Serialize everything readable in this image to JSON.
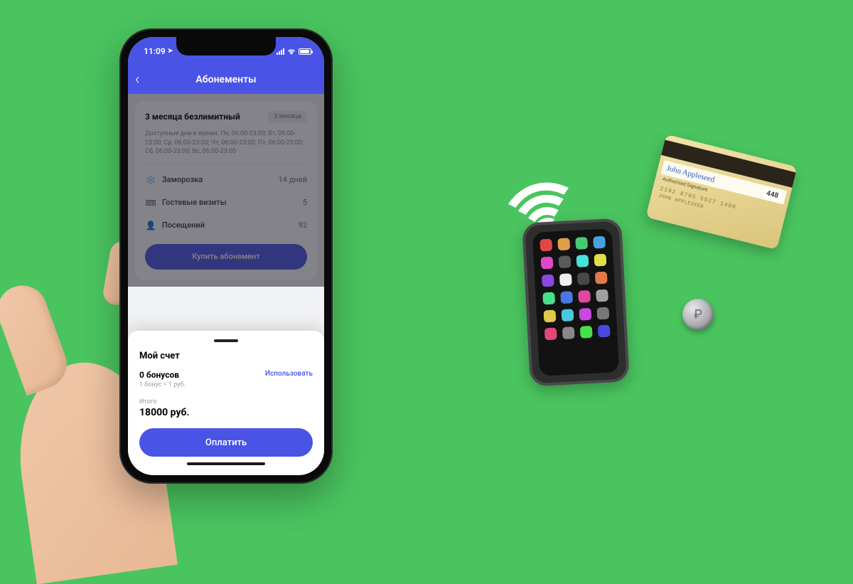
{
  "status": {
    "time": "11:09",
    "location_icon": "➤"
  },
  "nav": {
    "title": "Абонементы"
  },
  "plan": {
    "title": "3 месяца безлимитный",
    "badge": "3 месяца",
    "schedule_label": "Доступные дни и время:",
    "schedule_text": "Пн, 06:00-23:00; Вт, 06:00-23:00; Ср, 06:00-23:00; Чт, 06:00-23:00; Пт, 06:00-23:00; Сб, 06:00-23:00; Вс, 06:00-23:00",
    "rows": [
      {
        "icon": "❄️",
        "label": "Заморозка",
        "value": "14 дней"
      },
      {
        "icon": "🎟",
        "label": "Гостевые визиты",
        "value": "5"
      },
      {
        "icon": "👤",
        "label": "Посещений",
        "value": "92"
      }
    ],
    "buy_label": "Купить абонемент"
  },
  "sheet": {
    "title": "Мой счет",
    "bonus_amount": "0 бонусов",
    "bonus_rate": "1 бонус = 1 руб.",
    "use_label": "Использовать",
    "total_label": "Итого",
    "total_amount": "18000 руб.",
    "pay_label": "Оплатить"
  },
  "credit_card": {
    "signature": "John Appleseed",
    "auth_label": "Authorized Signature",
    "cvv": "448",
    "number": "2192 8765 5527 1480",
    "name": "JOHN APPLESEED"
  },
  "deco_app_colors": [
    "#e04848",
    "#e0a048",
    "#48c871",
    "#48a0e0",
    "#e048c8",
    "#5a5a5a",
    "#48e0d8",
    "#e0e048",
    "#8b48e0",
    "#f0f0f0",
    "#484848",
    "#e07a48",
    "#48e088",
    "#4878e0",
    "#e048a0",
    "#a0a0a0",
    "#e0c848",
    "#48c8e0",
    "#c848e0",
    "#787878",
    "#e04878",
    "#888888",
    "#48e048",
    "#4848e0"
  ]
}
